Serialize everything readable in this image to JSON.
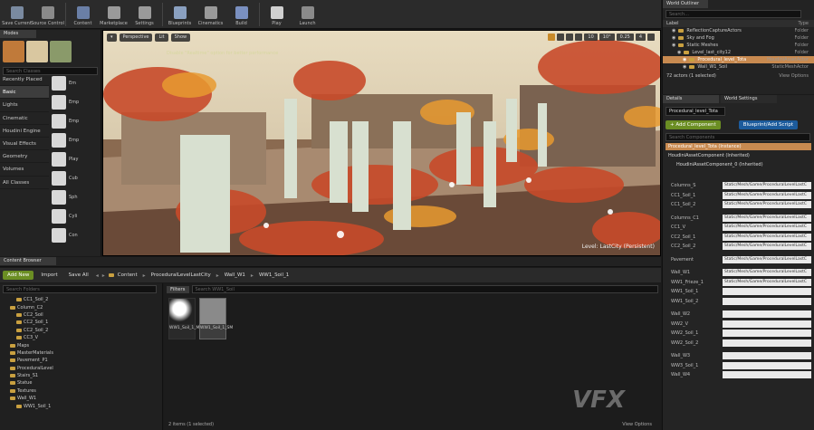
{
  "toolbar": {
    "buttons": [
      {
        "label": "Save Current",
        "color": "#7a8aa0"
      },
      {
        "label": "Source Control",
        "color": "#8a8a8a"
      },
      {
        "label": "Content",
        "color": "#6a7fa6"
      },
      {
        "label": "Marketplace",
        "color": "#9a9a9a"
      },
      {
        "label": "Settings",
        "color": "#9a9a9a"
      },
      {
        "label": "Blueprints",
        "color": "#8aa0c0"
      },
      {
        "label": "Cinematics",
        "color": "#9a9a9a"
      },
      {
        "label": "Build",
        "color": "#7a90c0"
      },
      {
        "label": "Play",
        "color": "#d0d0d0"
      },
      {
        "label": "Launch",
        "color": "#8a8a8a"
      }
    ]
  },
  "modes": {
    "tab": "Modes",
    "search_placeholder": "Search Classes",
    "categories": [
      "Recently Placed",
      "Basic",
      "Lights",
      "Cinematic",
      "Houdini Engine",
      "Visual Effects",
      "Geometry",
      "Volumes",
      "All Classes"
    ],
    "selected_category": "Basic",
    "items": [
      "Em",
      "Emp",
      "Emp",
      "Emp",
      "Play",
      "Cub",
      "Sph",
      "Cyli",
      "Con"
    ]
  },
  "viewport": {
    "perspective_label": "Perspective",
    "lit_label": "Lit",
    "show_label": "Show",
    "grid_snap": "10",
    "rotation_snap": "10°",
    "scale_snap": "0.25",
    "camera_speed": "4",
    "note": "Disable \"Realtime\" option for better performance",
    "level_label": "Level: LastCity (Persistent)"
  },
  "content_browser": {
    "tab": "Content Browser",
    "add_new": "Add New",
    "import": "Import",
    "save_all": "Save All",
    "breadcrumbs": [
      "Content",
      "ProceduralLevelLastCity",
      "Wall_W1",
      "WW1_Soil_1"
    ],
    "search_folders": "Search Folders",
    "filters": "Filters",
    "search_assets": "Search WW1_Soil",
    "tree": [
      {
        "label": "CC1_Soil_2",
        "indent": 2
      },
      {
        "label": "Column_C2",
        "indent": 1
      },
      {
        "label": "CC2_Soil",
        "indent": 2
      },
      {
        "label": "CC2_Soil_1",
        "indent": 2
      },
      {
        "label": "CC2_Soil_2",
        "indent": 2
      },
      {
        "label": "CC3_V",
        "indent": 2
      },
      {
        "label": "Maps",
        "indent": 1
      },
      {
        "label": "MasterMaterials",
        "indent": 1
      },
      {
        "label": "Pavement_P1",
        "indent": 1
      },
      {
        "label": "ProceduralLevel",
        "indent": 1
      },
      {
        "label": "Stairs_S1",
        "indent": 1
      },
      {
        "label": "Statue",
        "indent": 1
      },
      {
        "label": "Textures",
        "indent": 1
      },
      {
        "label": "Wall_W1",
        "indent": 1
      },
      {
        "label": "WW1_Soil_1",
        "indent": 2
      }
    ],
    "assets": [
      {
        "label": "WW1_Soil_1_M",
        "selected": false
      },
      {
        "label": "WW1_Soil_1_SM",
        "selected": true
      }
    ],
    "status": "2 items (1 selected)",
    "view_options": "View Options"
  },
  "outliner": {
    "tab": "World Outliner",
    "search_placeholder": "Search...",
    "header_label": "Label",
    "header_type": "Type",
    "rows": [
      {
        "label": "ReflectionCaptureActors",
        "type": "Folder",
        "indent": 1,
        "selected": false
      },
      {
        "label": "Sky and Fog",
        "type": "Folder",
        "indent": 1,
        "selected": false
      },
      {
        "label": "Static Meshes",
        "type": "Folder",
        "indent": 1,
        "selected": false
      },
      {
        "label": "Level_last_city12",
        "type": "Folder",
        "indent": 2,
        "selected": false
      },
      {
        "label": "Procedural_level_Tota",
        "type": "HoudiniAssetActor",
        "indent": 3,
        "selected": true
      },
      {
        "label": "Wall_W1_Soil",
        "type": "StaticMeshActor",
        "indent": 3,
        "selected": false
      }
    ],
    "footer": "72 actors (1 selected)",
    "view_options": "View Options"
  },
  "details": {
    "tab_details": "Details",
    "tab_world": "World Settings",
    "name_field": "Procedural_level_Tota",
    "add_component": "+ Add Component",
    "blueprint": "Blueprint/Add Script",
    "search_components": "Search Components",
    "component_self": "Procedural_level_Tota (Instance)",
    "component_child": "HoudiniAssetComponent (Inherited)",
    "component_sub": "HoudiniAssetComponent_0 (Inherited)",
    "properties": [
      {
        "label": "Columns_S",
        "value": "Static/Mesh/Game/ProceduralLevelLastC"
      },
      {
        "label": "CC1_Soil_1",
        "value": "Static/Mesh/Game/ProceduralLevelLastC"
      },
      {
        "label": "CC1_Soil_2",
        "value": "Static/Mesh/Game/ProceduralLevelLastC"
      },
      {
        "gap": true
      },
      {
        "label": "Columns_C1",
        "value": "Static/Mesh/Game/ProceduralLevelLastC"
      },
      {
        "label": "CC1_V",
        "value": "Static/Mesh/Game/ProceduralLevelLastC"
      },
      {
        "label": "CC2_Soil_1",
        "value": "Static/Mesh/Game/ProceduralLevelLastC"
      },
      {
        "label": "CC2_Soil_2",
        "value": "Static/Mesh/Game/ProceduralLevelLastC"
      },
      {
        "gap": true
      },
      {
        "label": "Pavement",
        "value": "Static/Mesh/Game/ProceduralLevelLastC"
      },
      {
        "gap": true
      },
      {
        "label": "Wall_W1",
        "value": "Static/Mesh/Game/ProceduralLevelLastC"
      },
      {
        "label": "WW1_Frieze_1",
        "value": "Static/Mesh/Game/ProceduralLevelLastC"
      },
      {
        "label": "WW1_Soil_1",
        "value": ""
      },
      {
        "label": "WW1_Soil_2",
        "value": ""
      },
      {
        "gap": true
      },
      {
        "label": "Wall_W2",
        "value": ""
      },
      {
        "label": "WW2_V",
        "value": ""
      },
      {
        "label": "WW2_Soil_1",
        "value": ""
      },
      {
        "label": "WW2_Soil_2",
        "value": ""
      },
      {
        "gap": true
      },
      {
        "label": "Wall_W3",
        "value": ""
      },
      {
        "label": "WW3_Soil_1",
        "value": ""
      },
      {
        "label": "Wall_W4",
        "value": ""
      }
    ]
  },
  "watermark": "VFX"
}
